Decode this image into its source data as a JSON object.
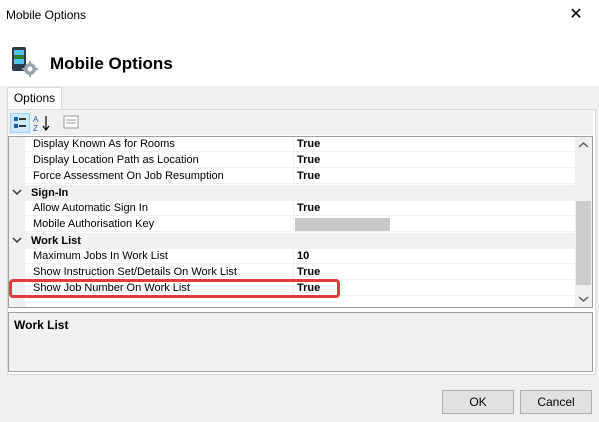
{
  "window": {
    "title": "Mobile Options",
    "close_glyph": "✕"
  },
  "header": {
    "title": "Mobile Options",
    "icon": "mobile-settings-icon"
  },
  "tabs": [
    {
      "label": "Options"
    }
  ],
  "toolbar": {
    "categorized_icon": "categorized-icon",
    "alphabetical_icon": "alphabetical-sort-icon",
    "pages_icon": "property-pages-icon"
  },
  "grid": {
    "rows": [
      {
        "type": "property",
        "name": "Display Known As for Rooms",
        "value": "True"
      },
      {
        "type": "property",
        "name": "Display Location Path as Location",
        "value": "True"
      },
      {
        "type": "property",
        "name": "Force Assessment On Job Resumption",
        "value": "True"
      },
      {
        "type": "category",
        "name": "Sign-In"
      },
      {
        "type": "property",
        "name": "Allow Automatic Sign In",
        "value": "True"
      },
      {
        "type": "property",
        "name": "Mobile Authorisation Key",
        "value": ""
      },
      {
        "type": "category",
        "name": "Work List"
      },
      {
        "type": "property",
        "name": "Maximum Jobs In Work List",
        "value": "10"
      },
      {
        "type": "property",
        "name": "Show Instruction Set/Details On Work List",
        "value": "True"
      },
      {
        "type": "property",
        "name": "Show Job Number On Work List",
        "value": "True"
      }
    ]
  },
  "description": {
    "title": "Work List"
  },
  "buttons": {
    "ok": "OK",
    "cancel": "Cancel"
  },
  "colors": {
    "highlight": "#e03c3c",
    "selection": "#0078d7"
  }
}
